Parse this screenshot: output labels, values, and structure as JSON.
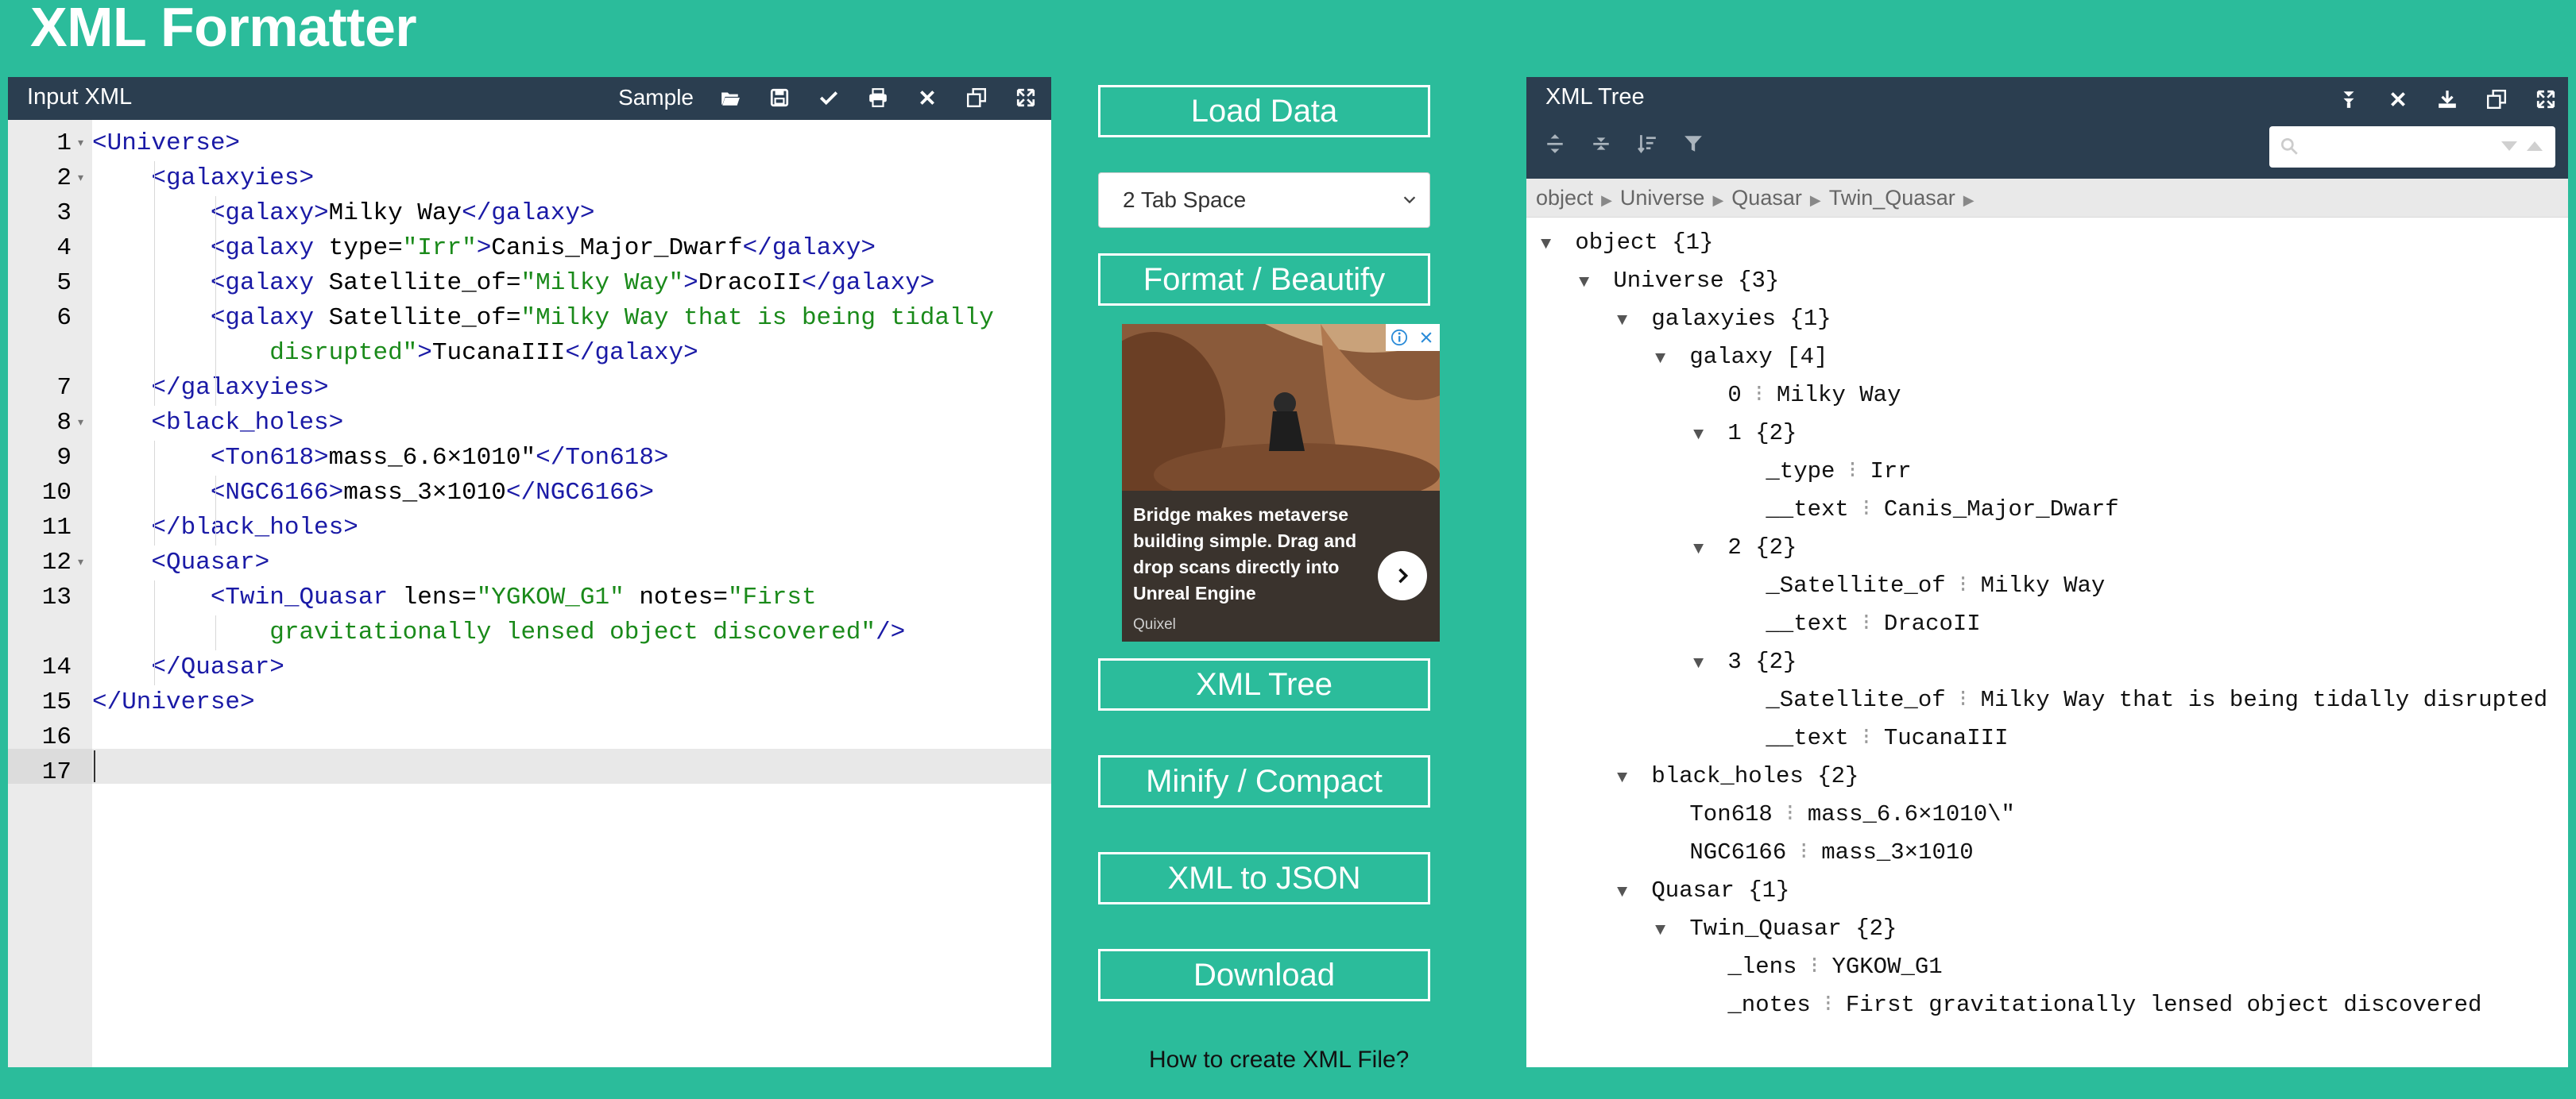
{
  "app_title": "XML Formatter",
  "input_panel": {
    "title": "Input XML",
    "sample_label": "Sample",
    "tools": [
      "folder-open-icon",
      "save-icon",
      "check-icon",
      "print-icon",
      "close-icon",
      "copy-icon",
      "fullscreen-icon"
    ],
    "line_numbers": [
      "1",
      "2",
      "3",
      "4",
      "5",
      "6",
      "7",
      "8",
      "9",
      "10",
      "11",
      "12",
      "13",
      "14",
      "15",
      "16",
      "17"
    ]
  },
  "middle": {
    "load_data": "Load Data",
    "indent_select": "2 Tab Space",
    "format": "Format / Beautify",
    "xml_tree": "XML Tree",
    "minify": "Minify / Compact",
    "xml_to_json": "XML to JSON",
    "download": "Download",
    "how_to": "How to create XML File?",
    "ad": {
      "headline": "Bridge makes metaverse building simple. Drag and drop scans directly into Unreal Engine",
      "brand": "Quixel"
    }
  },
  "tree_panel": {
    "title": "XML Tree",
    "breadcrumb": [
      "object",
      "Universe",
      "Quasar",
      "Twin_Quasar"
    ],
    "rows": [
      {
        "indent": 0,
        "tri": "▼",
        "key": "object",
        "val": " {1}"
      },
      {
        "indent": 1,
        "tri": "▼",
        "key": "Universe",
        "val": " {3}"
      },
      {
        "indent": 2,
        "tri": "▼",
        "key": "galaxyies",
        "val": " {1}"
      },
      {
        "indent": 3,
        "tri": "▼",
        "key": "galaxy",
        "val": " [4]"
      },
      {
        "indent": 4,
        "tri": "",
        "key": "0",
        "colon": true,
        "val": "Milky Way"
      },
      {
        "indent": 4,
        "tri": "▼",
        "key": "1",
        "val": " {2}"
      },
      {
        "indent": 5,
        "tri": "",
        "key": "_type",
        "colon": true,
        "val": "Irr"
      },
      {
        "indent": 5,
        "tri": "",
        "key": "__text",
        "colon": true,
        "val": "Canis_Major_Dwarf"
      },
      {
        "indent": 4,
        "tri": "▼",
        "key": "2",
        "val": " {2}"
      },
      {
        "indent": 5,
        "tri": "",
        "key": "_Satellite_of",
        "colon": true,
        "val": "Milky Way"
      },
      {
        "indent": 5,
        "tri": "",
        "key": "__text",
        "colon": true,
        "val": "DracoII"
      },
      {
        "indent": 4,
        "tri": "▼",
        "key": "3",
        "val": " {2}"
      },
      {
        "indent": 5,
        "tri": "",
        "key": "_Satellite_of",
        "colon": true,
        "val": "Milky Way that is being tidally disrupted"
      },
      {
        "indent": 5,
        "tri": "",
        "key": "__text",
        "colon": true,
        "val": "TucanaIII"
      },
      {
        "indent": 2,
        "tri": "▼",
        "key": "black_holes",
        "val": " {2}"
      },
      {
        "indent": 3,
        "tri": "",
        "key": "Ton618",
        "colon": true,
        "val": "mass_6.6×1010\\\""
      },
      {
        "indent": 3,
        "tri": "",
        "key": "NGC6166",
        "colon": true,
        "val": "mass_3×1010"
      },
      {
        "indent": 2,
        "tri": "▼",
        "key": "Quasar",
        "val": " {1}"
      },
      {
        "indent": 3,
        "tri": "▼",
        "key": "Twin_Quasar",
        "val": " {2}"
      },
      {
        "indent": 4,
        "tri": "",
        "key": "_lens",
        "colon": true,
        "val": "YGKOW_G1"
      },
      {
        "indent": 4,
        "tri": "",
        "key": "_notes",
        "colon": true,
        "val": "First gravitationally lensed object discovered"
      }
    ]
  },
  "code_lines": [
    [
      [
        "tag",
        "<Universe>"
      ]
    ],
    [
      [
        "plain",
        "    "
      ],
      [
        "tag",
        "<galaxyies>"
      ]
    ],
    [
      [
        "plain",
        "        "
      ],
      [
        "tag",
        "<galaxy>"
      ],
      [
        "plain",
        "Milky Way"
      ],
      [
        "tag",
        "</galaxy>"
      ]
    ],
    [
      [
        "plain",
        "        "
      ],
      [
        "tag",
        "<galaxy "
      ],
      [
        "attr",
        "type="
      ],
      [
        "str",
        "\"Irr\""
      ],
      [
        "tag",
        ">"
      ],
      [
        "plain",
        "Canis_Major_Dwarf"
      ],
      [
        "tag",
        "</galaxy>"
      ]
    ],
    [
      [
        "plain",
        "        "
      ],
      [
        "tag",
        "<galaxy "
      ],
      [
        "attr",
        "Satellite_of="
      ],
      [
        "str",
        "\"Milky Way\""
      ],
      [
        "tag",
        ">"
      ],
      [
        "plain",
        "DracoII"
      ],
      [
        "tag",
        "</galaxy>"
      ]
    ],
    [
      [
        "plain",
        "        "
      ],
      [
        "tag",
        "<galaxy "
      ],
      [
        "attr",
        "Satellite_of="
      ],
      [
        "str",
        "\"Milky Way that is being tidally"
      ]
    ],
    [
      [
        "plain",
        "            "
      ],
      [
        "str",
        "disrupted\""
      ],
      [
        "tag",
        ">"
      ],
      [
        "plain",
        "TucanaIII"
      ],
      [
        "tag",
        "</galaxy>"
      ]
    ],
    [
      [
        "plain",
        "    "
      ],
      [
        "tag",
        "</galaxyies>"
      ]
    ],
    [
      [
        "plain",
        "    "
      ],
      [
        "tag",
        "<black_holes>"
      ]
    ],
    [
      [
        "plain",
        "        "
      ],
      [
        "tag",
        "<Ton618>"
      ],
      [
        "plain",
        "mass_6.6×1010\""
      ],
      [
        "tag",
        "</Ton618>"
      ]
    ],
    [
      [
        "plain",
        "        "
      ],
      [
        "tag",
        "<NGC6166>"
      ],
      [
        "plain",
        "mass_3×1010"
      ],
      [
        "tag",
        "</NGC6166>"
      ]
    ],
    [
      [
        "plain",
        "    "
      ],
      [
        "tag",
        "</black_holes>"
      ]
    ],
    [
      [
        "plain",
        "    "
      ],
      [
        "tag",
        "<Quasar>"
      ]
    ],
    [
      [
        "plain",
        "        "
      ],
      [
        "tag",
        "<Twin_Quasar "
      ],
      [
        "attr",
        "lens="
      ],
      [
        "str",
        "\"YGKOW_G1\""
      ],
      [
        "attr",
        " notes="
      ],
      [
        "str",
        "\"First"
      ]
    ],
    [
      [
        "plain",
        "            "
      ],
      [
        "str",
        "gravitationally lensed object discovered\""
      ],
      [
        "tag",
        "/>"
      ]
    ],
    [
      [
        "plain",
        "    "
      ],
      [
        "tag",
        "</Quasar>"
      ]
    ],
    [
      [
        "tag",
        "</Universe>"
      ]
    ]
  ]
}
